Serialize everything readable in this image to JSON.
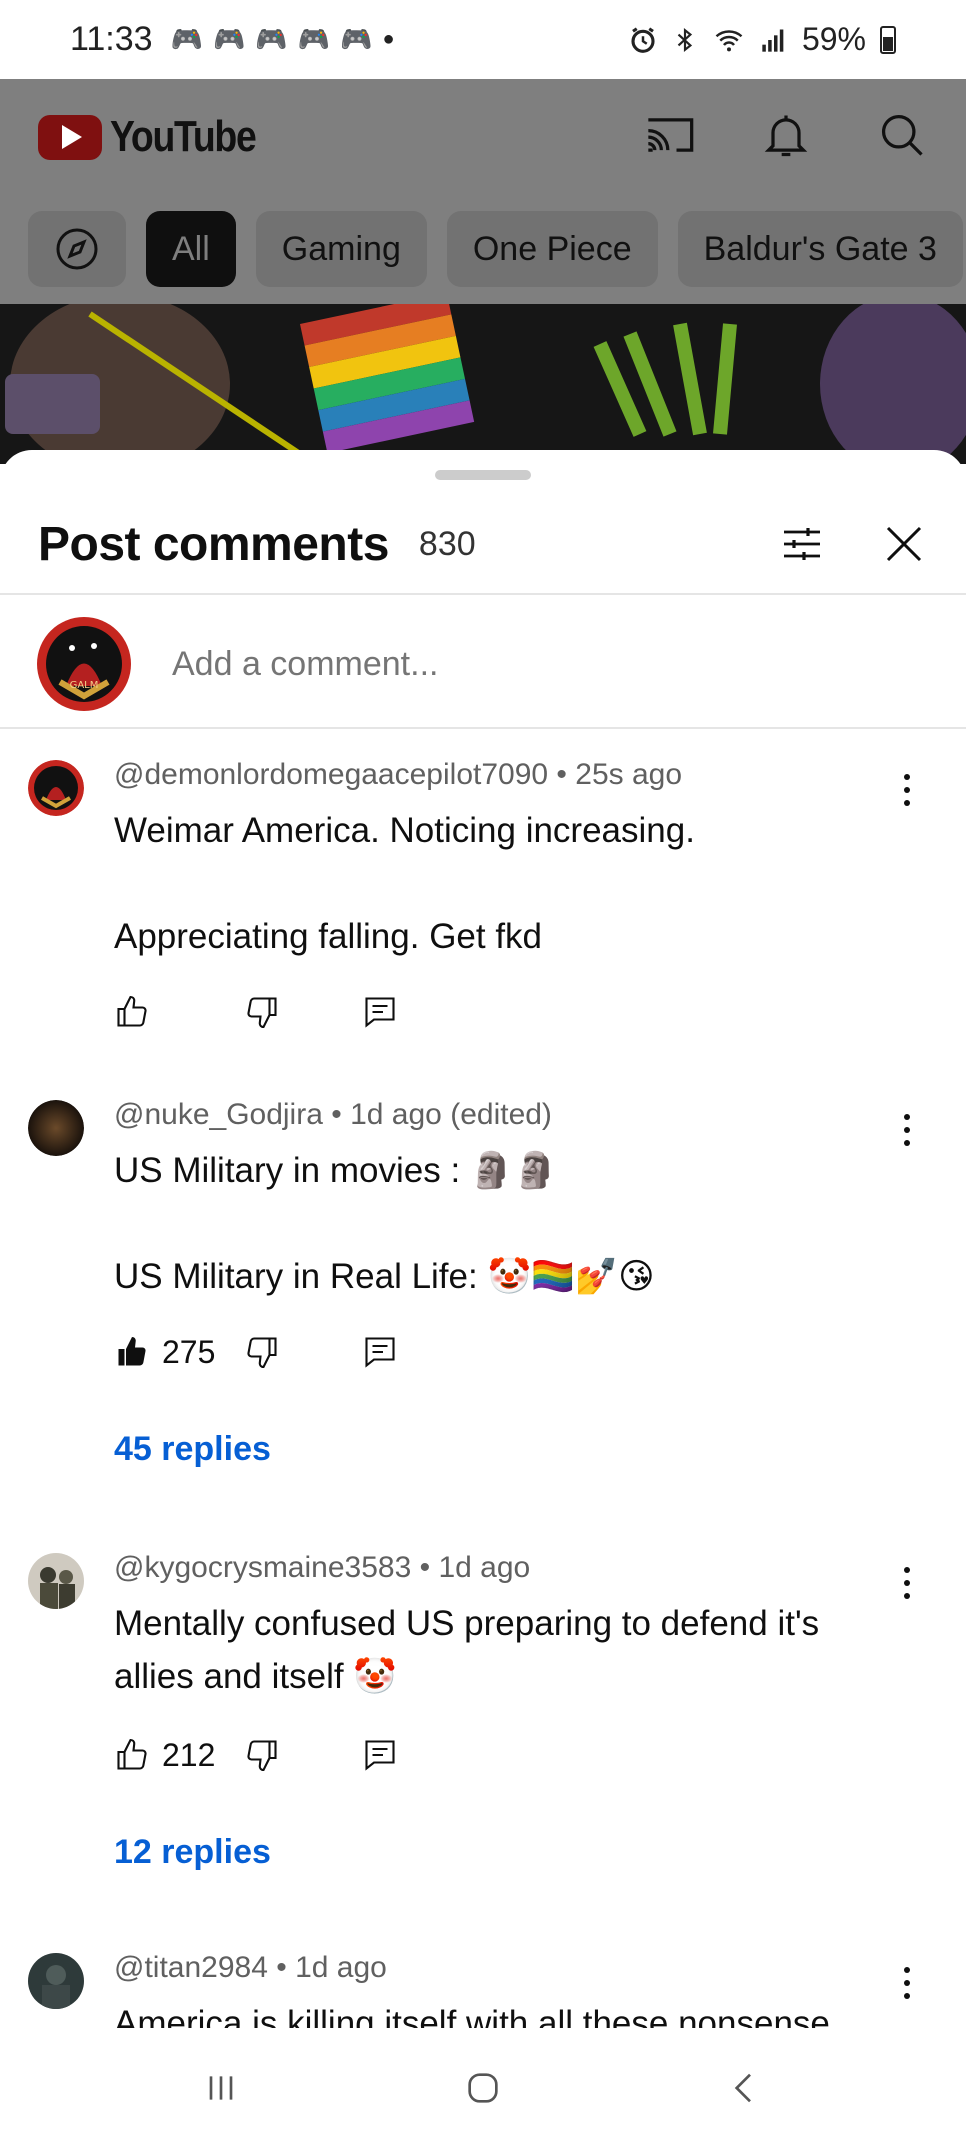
{
  "status_bar": {
    "time": "11:33",
    "battery": "59%",
    "notifications": [
      "game-controller-icon",
      "game-controller-icon",
      "game-controller-icon",
      "game-controller-icon",
      "game-controller-icon"
    ]
  },
  "header": {
    "logo_text": "YouTube",
    "icons": [
      "cast-icon",
      "bell-icon",
      "search-icon"
    ]
  },
  "chips": [
    {
      "label": "All",
      "active": true
    },
    {
      "label": "Gaming",
      "active": false
    },
    {
      "label": "One Piece",
      "active": false
    },
    {
      "label": "Baldur's Gate 3",
      "active": false
    }
  ],
  "sheet": {
    "title": "Post comments",
    "count": "830",
    "add_comment_placeholder": "Add a comment..."
  },
  "comments": [
    {
      "author": "@demonlordomegaacepilot7090",
      "time": "25s ago",
      "edited": "",
      "text": "Weimar America. Noticing increasing.\n\nAppreciating falling. Get fkd",
      "likes": "",
      "replies": ""
    },
    {
      "author": "@nuke_Godjira",
      "time": "1d ago",
      "edited": "(edited)",
      "text": "US Military in movies : 🗿🗿\n\nUS Military in Real Life: 🤡🏳️‍🌈💅😘",
      "likes": "275",
      "replies": "45 replies"
    },
    {
      "author": "@kygocrysmaine3583",
      "time": "1d ago",
      "edited": "",
      "text": "Mentally confused US preparing to defend it's allies and itself 🤡",
      "likes": "212",
      "replies": "12 replies"
    },
    {
      "author": "@titan2984",
      "time": "1d ago",
      "edited": "",
      "text": "America is killing itself with all these nonsense",
      "likes": "",
      "replies": ""
    }
  ],
  "colors": {
    "accent_link": "#065fd4",
    "youtube_red": "#ff0000",
    "overlay_gray": "#7f7f7f"
  }
}
